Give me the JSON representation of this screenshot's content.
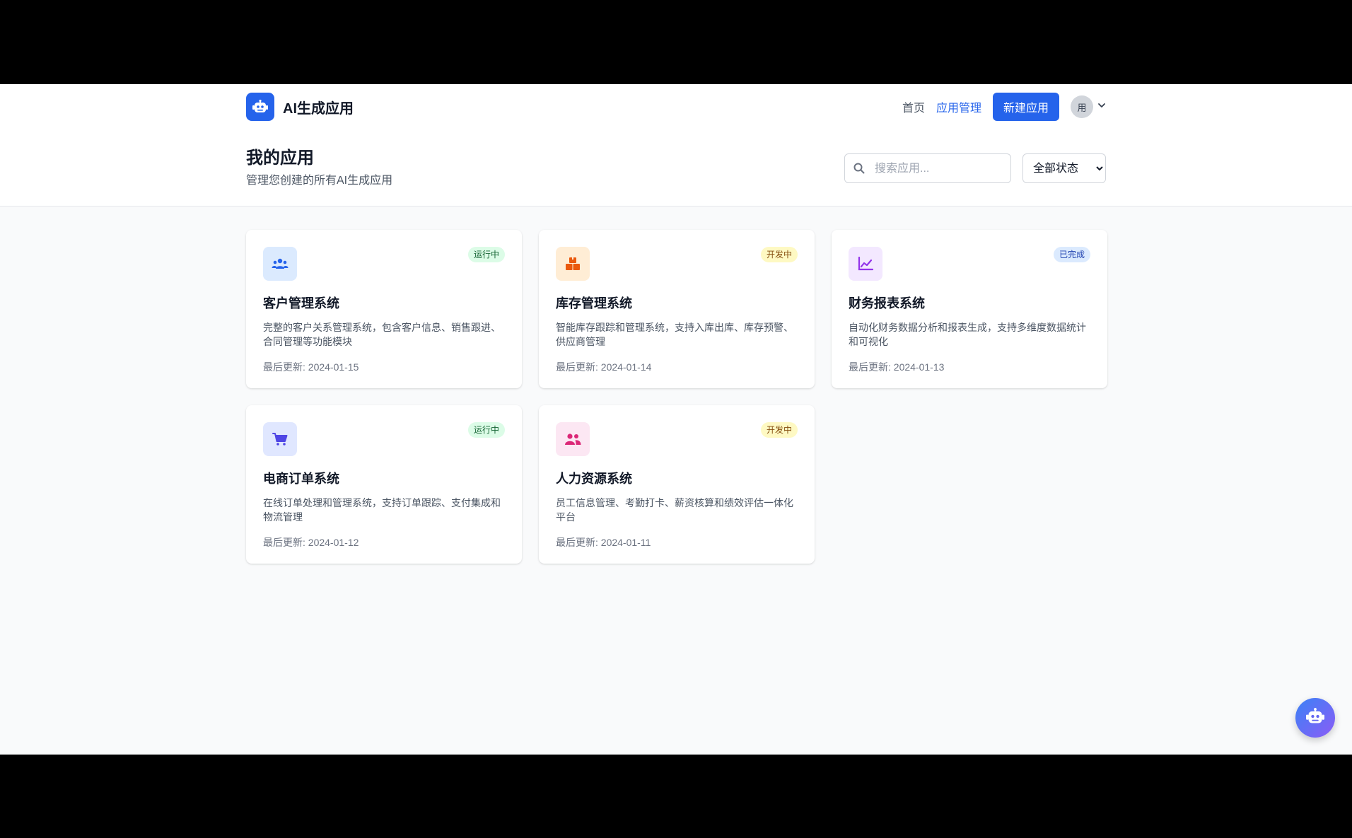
{
  "brand": {
    "name": "AI生成应用",
    "logo_icon": "robot-icon",
    "accent": "#2563eb"
  },
  "nav": {
    "home": "首页",
    "apps": "应用管理",
    "new_app": "新建应用",
    "avatar_text": "用"
  },
  "page": {
    "title": "我的应用",
    "subtitle": "管理您创建的所有AI生成应用"
  },
  "search": {
    "placeholder": "搜索应用..."
  },
  "filter": {
    "selected": "全部状态"
  },
  "apps": [
    {
      "name": "客户管理系统",
      "icon": "users-icon",
      "status": "运行中",
      "status_type": "running",
      "description": "完整的客户关系管理系统，包含客户信息、销售跟进、合同管理等功能模块",
      "updated": "最后更新: 2024-01-15"
    },
    {
      "name": "库存管理系统",
      "icon": "boxes-icon",
      "status": "开发中",
      "status_type": "developing",
      "description": "智能库存跟踪和管理系统，支持入库出库、库存预警、供应商管理",
      "updated": "最后更新: 2024-01-14"
    },
    {
      "name": "财务报表系统",
      "icon": "chart-line-icon",
      "status": "已完成",
      "status_type": "completed",
      "description": "自动化财务数据分析和报表生成，支持多维度数据统计和可视化",
      "updated": "最后更新: 2024-01-13"
    },
    {
      "name": "电商订单系统",
      "icon": "shopping-cart-icon",
      "status": "运行中",
      "status_type": "running",
      "description": "在线订单处理和管理系统，支持订单跟踪、支付集成和物流管理",
      "updated": "最后更新: 2024-01-12"
    },
    {
      "name": "人力资源系统",
      "icon": "user-group-icon",
      "status": "开发中",
      "status_type": "developing",
      "description": "员工信息管理、考勤打卡、薪资核算和绩效评估一体化平台",
      "updated": "最后更新: 2024-01-11"
    }
  ],
  "colors": {
    "running_bg": "#dcfce7",
    "running_fg": "#166534",
    "developing_bg": "#fef9c3",
    "developing_fg": "#854d0e",
    "completed_bg": "#dbeafe",
    "completed_fg": "#1e40af"
  }
}
